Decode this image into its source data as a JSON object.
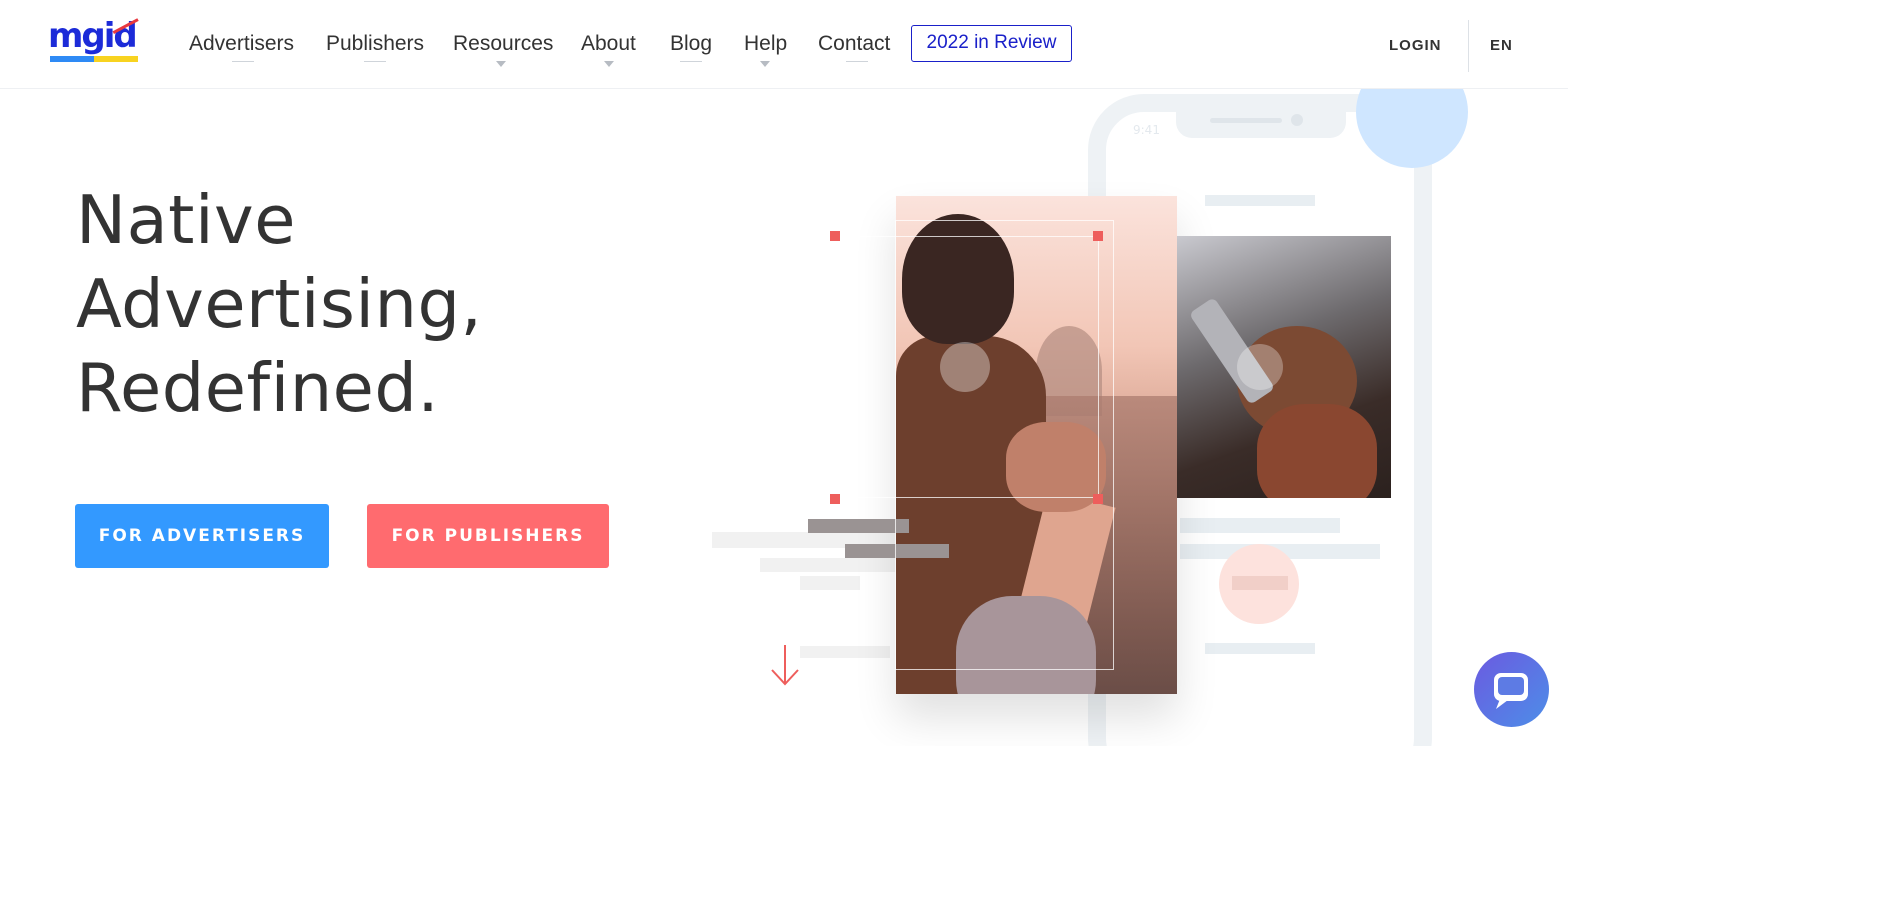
{
  "header": {
    "logo_text": "mgid",
    "nav": [
      {
        "label": "Advertisers",
        "has_dropdown": false
      },
      {
        "label": "Publishers",
        "has_dropdown": false
      },
      {
        "label": "Resources",
        "has_dropdown": true
      },
      {
        "label": "About",
        "has_dropdown": true
      },
      {
        "label": "Blog",
        "has_dropdown": false
      },
      {
        "label": "Help",
        "has_dropdown": true
      },
      {
        "label": "Contact",
        "has_dropdown": false
      }
    ],
    "review_button": "2022 in Review",
    "login": "LOGIN",
    "language": "EN"
  },
  "hero": {
    "headline_lines": [
      "Native",
      "Advertising,",
      "Redefined."
    ],
    "advertisers_button": "FOR ADVERTISERS",
    "publishers_button": "FOR PUBLISHERS",
    "phone_time": "9:41"
  },
  "colors": {
    "brand_blue": "#1a20c9",
    "advertisers_button": "#3399ff",
    "publishers_button": "#ff6b6f",
    "accent_red": "#ee5e5c"
  },
  "icons": {
    "chat": "chat-bubble-icon",
    "scroll": "arrow-down-icon",
    "dropdown": "caret-down-icon"
  }
}
